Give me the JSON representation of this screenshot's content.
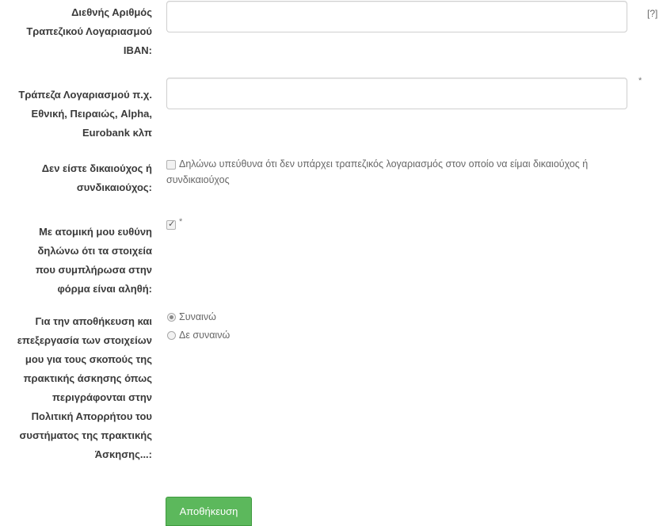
{
  "fields": {
    "iban": {
      "label": "Διεθνής Αριθμός Τραπεζικού Λογαριασμού IBAN:",
      "value": "",
      "help": "[?]"
    },
    "bank": {
      "label": "Τράπεζα Λογαριασμού π.χ. Εθνική, Πειραιώς, Alpha, Eurobank κλπ",
      "value": "",
      "required": "*"
    },
    "no_account": {
      "label": "Δεν είστε δικαιούχος ή συνδικαιούχος:",
      "checkbox_text": "Δηλώνω υπεύθυνα ότι δεν υπάρχει τραπεζικός λογαριασμός στον οποίο να είμαι δικαιούχος ή συνδικαιούχος",
      "checked": false
    },
    "truth_declaration": {
      "label": "Με ατομική μου ευθύνη δηλώνω ότι τα στοιχεία που συμπλήρωσα στην φόρμα είναι αληθή:",
      "checked": true,
      "required": "*"
    },
    "consent": {
      "label": "Για την αποθήκευση και επεξεργασία των στοιχείων μου για τους σκοπούς της πρακτικής άσκησης όπως περιγράφονται στην Πολιτική Απορρήτου του συστήματος της πρακτικής Άσκησης...:",
      "options": [
        "Συναινώ",
        "Δε συναινώ"
      ],
      "selected": "Συναινώ"
    }
  },
  "actions": {
    "save_label": "Αποθήκευση"
  },
  "colors": {
    "save_button": "#5cb85c",
    "label_text": "#3a3a3a",
    "input_border": "#cfcfcf"
  }
}
